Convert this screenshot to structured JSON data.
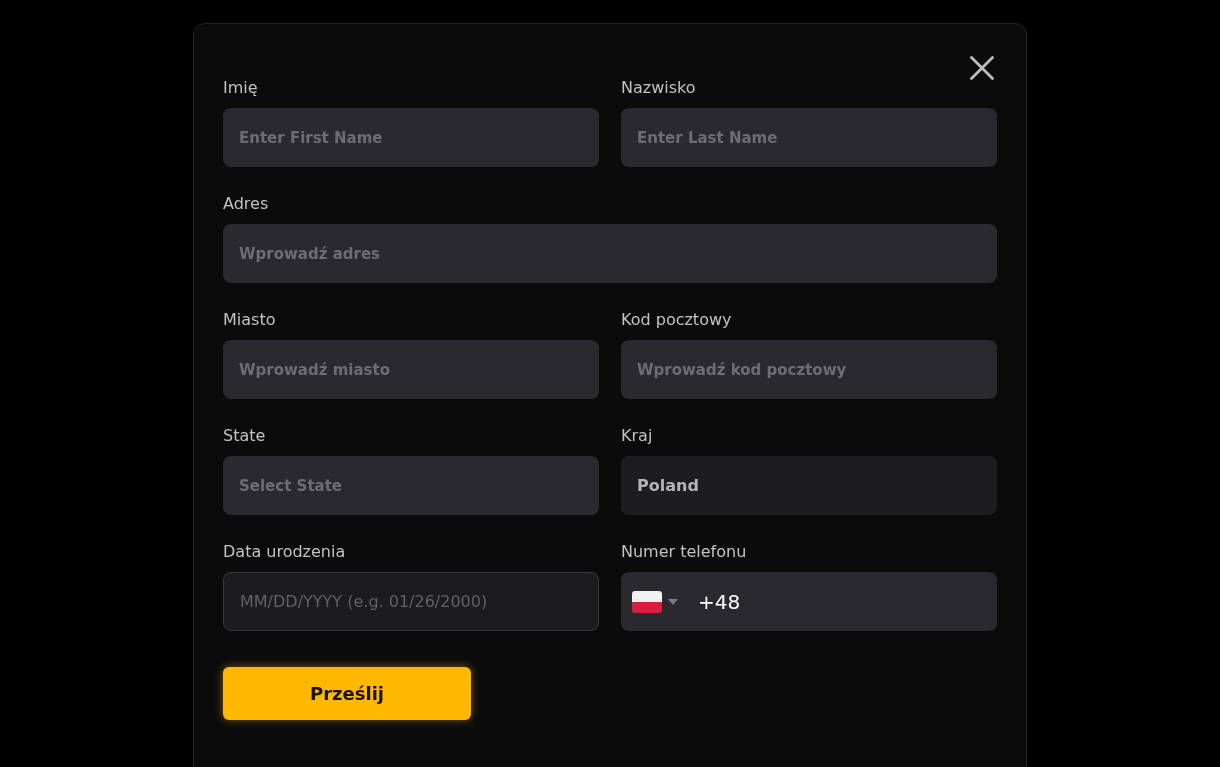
{
  "dialog": {
    "rows": [
      {
        "fields": [
          {
            "kind": "text",
            "label": "Imię",
            "placeholder": "Enter First Name",
            "disabled": false
          },
          {
            "kind": "text",
            "label": "Nazwisko",
            "placeholder": "Enter Last Name",
            "disabled": false
          }
        ]
      },
      {
        "fields": [
          {
            "kind": "text",
            "label": "Adres",
            "placeholder": "Wprowadź adres",
            "disabled": false
          }
        ]
      },
      {
        "fields": [
          {
            "kind": "text",
            "label": "Miasto",
            "placeholder": "Wprowadź miasto",
            "disabled": false
          },
          {
            "kind": "text",
            "label": "Kod pocztowy",
            "placeholder": "Wprowadź kod pocztowy",
            "disabled": false
          }
        ]
      },
      {
        "fields": [
          {
            "kind": "text",
            "label": "State",
            "placeholder": "Select State",
            "disabled": false
          },
          {
            "kind": "text",
            "label": "Kraj",
            "value": "Poland",
            "disabled": true
          }
        ]
      },
      {
        "fields": [
          {
            "kind": "date",
            "label": "Data urodzenia",
            "placeholder": "MM/DD/YYYY (e.g. 01/26/2000)",
            "disabled": false
          },
          {
            "kind": "phone",
            "label": "Numer telefonu",
            "value": "+48",
            "disabled": false
          }
        ]
      }
    ],
    "submit_button": {
      "label": "Prześlij"
    }
  }
}
